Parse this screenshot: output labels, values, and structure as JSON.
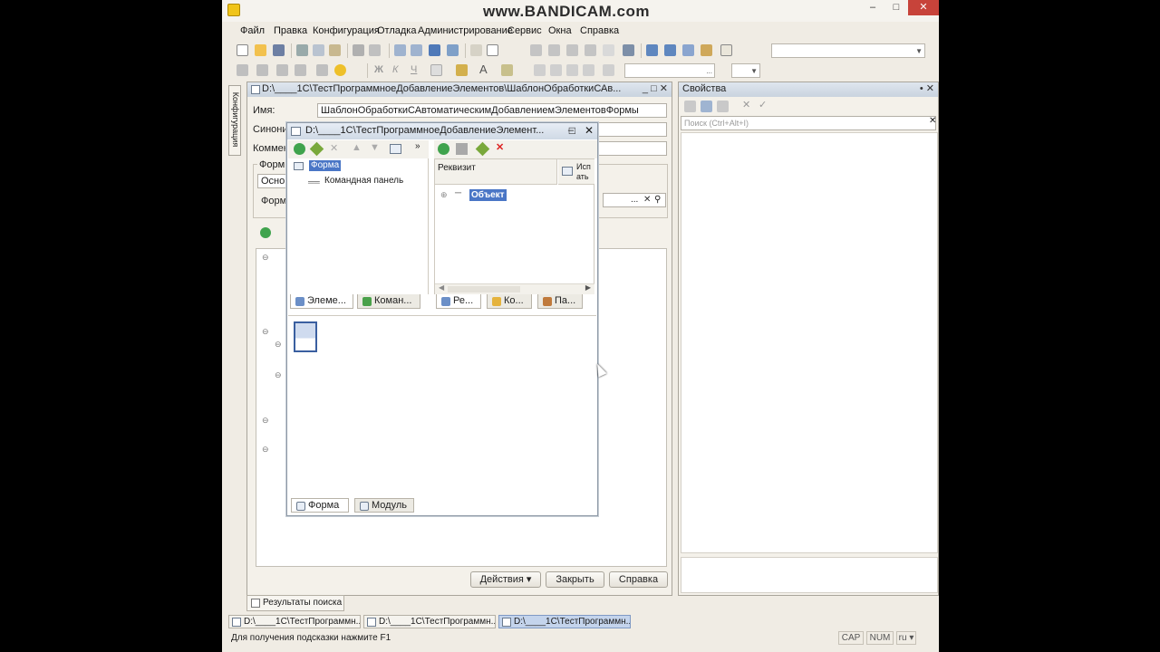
{
  "watermark": "www.BANDICAM.com",
  "menu": [
    {
      "label": "Файл"
    },
    {
      "label": "Правка"
    },
    {
      "label": "Конфигурация"
    },
    {
      "label": "Отладка"
    },
    {
      "label": "Администрирование"
    },
    {
      "label": "Сервис"
    },
    {
      "label": "Окна"
    },
    {
      "label": "Справка"
    }
  ],
  "config_tab": "Конфигурация",
  "processing_window": {
    "title": "D:\\____1C\\ТестПрограммноеДобавлениеЭлементов\\ШаблонОбработкиСАв...",
    "name_label": "Имя:",
    "name_value": "ШаблонОбработкиСАвтоматическимДобавлениемЭлементовФормы",
    "synonym_label": "Синоним",
    "comment_label": "Коммент",
    "forms_label": "Форм",
    "main_label": "Осно",
    "form_label": "Форм",
    "actions_button": "Действия",
    "close_button": "Закрыть",
    "help_button": "Справка"
  },
  "form_editor": {
    "title": "D:\\____1C\\ТестПрограммноеДобавлениеЭлемент...",
    "tree": {
      "root": "Форма",
      "child": "Командная панель"
    },
    "attrs": {
      "column_header": "Реквизит",
      "column_header2": "Исп ать",
      "item": "Объект"
    },
    "left_tabs": [
      "Элеме...",
      "Коман..."
    ],
    "right_tabs": [
      "Ре...",
      "Ко...",
      "Па..."
    ],
    "bottom_tabs": [
      "Форма",
      "Модуль"
    ]
  },
  "properties": {
    "title": "Свойства",
    "search_placeholder": "Поиск (Ctrl+Alt+I)"
  },
  "search_results_tab": "Результаты поиска",
  "taskbar": [
    {
      "label": "D:\\____1C\\ТестПрограммн..."
    },
    {
      "label": "D:\\____1C\\ТестПрограммн..."
    },
    {
      "label": "D:\\____1C\\ТестПрограммн..."
    }
  ],
  "status": {
    "hint": "Для получения подсказки нажмите F1",
    "cap": "CAP",
    "num": "NUM",
    "lang": "ru"
  }
}
